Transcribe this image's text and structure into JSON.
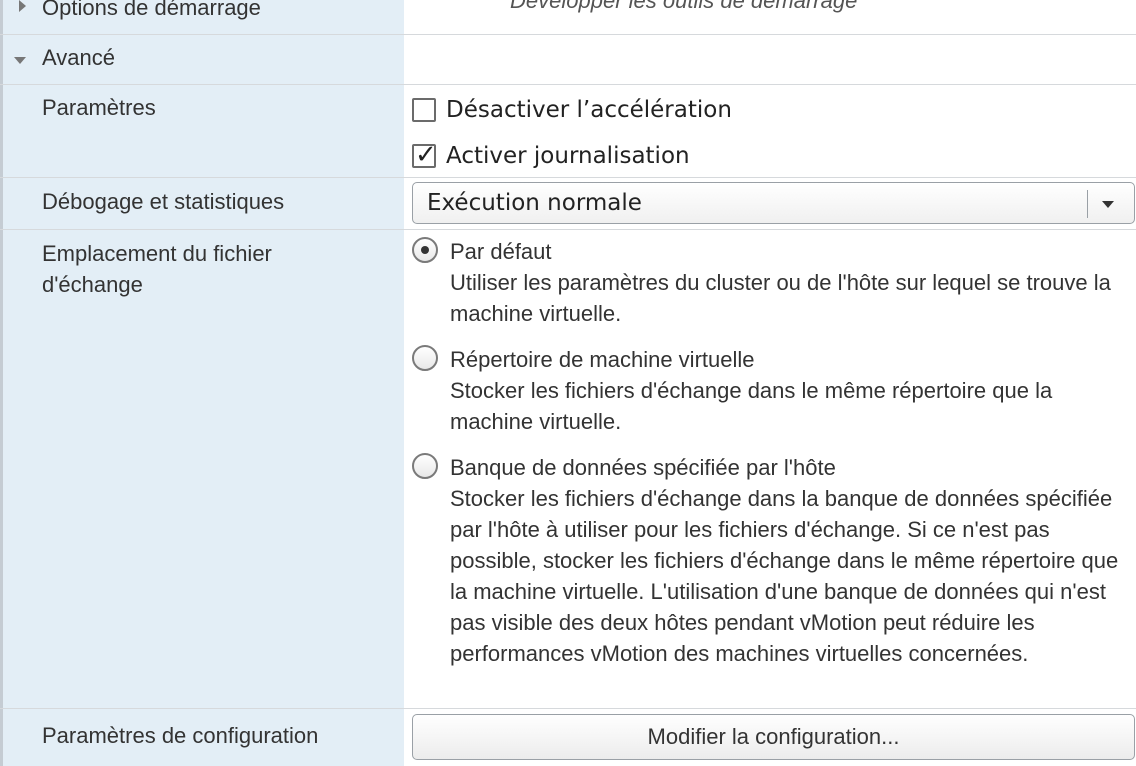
{
  "sections": {
    "boot_options": {
      "label": "Options de démarrage",
      "value": "Développer les outils de démarrage"
    },
    "advanced": {
      "label": "Avancé"
    }
  },
  "settings": {
    "label": "Paramètres",
    "disable_acceleration": {
      "label": "Désactiver l’accélération",
      "checked": false
    },
    "enable_logging": {
      "label": "Activer journalisation",
      "checked": true
    }
  },
  "debug": {
    "label": "Débogage et statistiques",
    "selected": "Exécution normale"
  },
  "swapfile": {
    "label": "Emplacement du fichier d'échange",
    "options": [
      {
        "title": "Par défaut",
        "desc": "Utiliser les paramètres du cluster ou de l'hôte sur lequel se trouve la machine virtuelle.",
        "selected": true
      },
      {
        "title": "Répertoire de machine virtuelle",
        "desc": "Stocker les fichiers d'échange dans le même répertoire que la machine virtuelle.",
        "selected": false
      },
      {
        "title": "Banque de données spécifiée par l'hôte",
        "desc": "Stocker les fichiers d'échange dans la banque de données spécifiée par l'hôte à utiliser pour les fichiers d'échange. Si ce n'est pas possible, stocker les fichiers d'échange dans le même répertoire que la machine virtuelle. L'utilisation d'une banque de données qui n'est pas visible des deux hôtes pendant vMotion peut réduire les performances vMotion des machines virtuelles concernées.",
        "selected": false
      }
    ]
  },
  "config": {
    "label": "Paramètres de configuration",
    "button": "Modifier la configuration..."
  }
}
